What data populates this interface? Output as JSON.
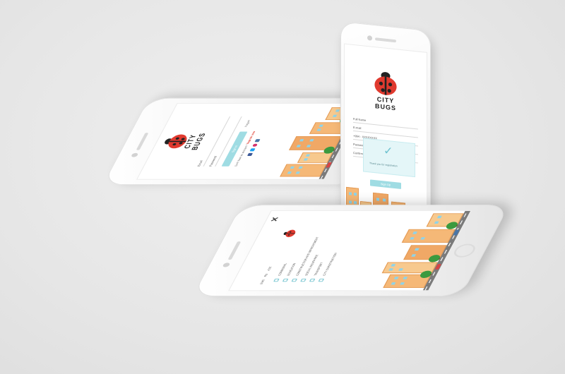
{
  "brand": {
    "logo_line1": "CITY",
    "logo_line2": "BUGS",
    "colors": {
      "accent": "#9fdce3",
      "ladybug_red": "#e03a2f",
      "building": "#f5b877",
      "background": "#e6e6e6"
    }
  },
  "login_screen": {
    "email_label": "Email",
    "password_label": "Password",
    "sign_in_label": "Sign in",
    "forgot_label": "Forgot?",
    "no_account_text": "Don't have an account ?",
    "register_link": "Register now",
    "social_icons": [
      "facebook-icon",
      "twitter-icon",
      "instagram-icon",
      "vk-icon"
    ]
  },
  "register_screen": {
    "full_name_label": "Full Name",
    "email_label": "E-mail",
    "phone_value": "+994 - XXXXXXXX",
    "password_label": "Password",
    "confirm_password_label": "Confirm Password",
    "success_message": "Thank you for registration",
    "sign_up_label": "Sign Up"
  },
  "menu_screen": {
    "close_icon": "close-icon",
    "languages": [
      "ENG",
      "RU",
      "AZE"
    ],
    "items": [
      {
        "label": "COMMUNAL",
        "icon": "communal-icon"
      },
      {
        "label": "EDUCATION",
        "icon": "education-icon"
      },
      {
        "label": "CONSTRUCTION AND IMPROVEMENT",
        "icon": "construction-icon"
      },
      {
        "label": "SOCIAL INSURANCE",
        "icon": "insurance-icon"
      },
      {
        "label": "TRANSPORT",
        "icon": "transport-icon"
      },
      {
        "label": "CITY CONSTRUCTION",
        "icon": "city-icon"
      }
    ]
  }
}
